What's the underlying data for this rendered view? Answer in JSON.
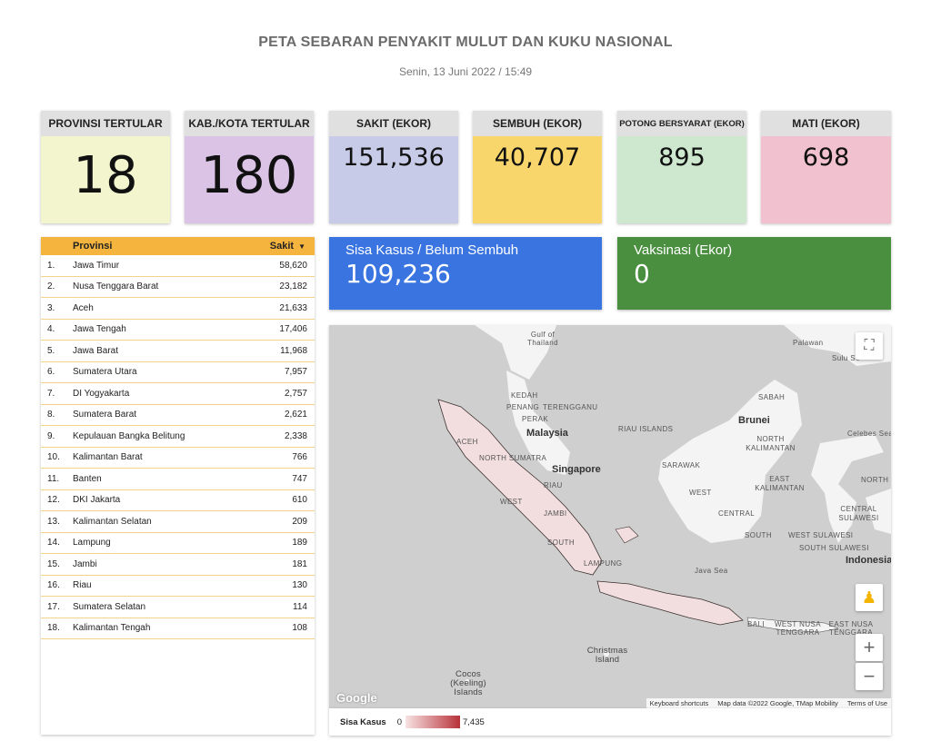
{
  "header": {
    "title": "PETA SEBARAN PENYAKIT MULUT DAN KUKU NASIONAL",
    "date": "Senin, 13 Juni 2022 / 15:49"
  },
  "cards": [
    {
      "label": "PROVINSI TERTULAR",
      "value": "18",
      "color": "#f2f5cd"
    },
    {
      "label": "KAB./KOTA TERTULAR",
      "value": "180",
      "color": "#dbc3e6"
    },
    {
      "label": "SAKIT (EKOR)",
      "value": "151,536",
      "color": "#c8cbe8"
    },
    {
      "label": "SEMBUH (EKOR)",
      "value": "40,707",
      "color": "#f8d66b"
    },
    {
      "label": "POTONG BERSYARAT (EKOR)",
      "value": "895",
      "color": "#cde8cf"
    },
    {
      "label": "MATI (EKOR)",
      "value": "698",
      "color": "#f2c1d0"
    }
  ],
  "sisa": {
    "label": "Sisa Kasus / Belum Sembuh",
    "value": "109,236",
    "color": "#3a74e0"
  },
  "vaksinasi": {
    "label": "Vaksinasi (Ekor)",
    "value": "0",
    "color": "#4a8f3f"
  },
  "table": {
    "col_name": "Provinsi",
    "col_value": "Sakit",
    "sort_icon": "triangle-down-icon",
    "rows": [
      {
        "n": "1.",
        "name": "Jawa Timur",
        "value": "58,620"
      },
      {
        "n": "2.",
        "name": "Nusa Tenggara Barat",
        "value": "23,182"
      },
      {
        "n": "3.",
        "name": "Aceh",
        "value": "21,633"
      },
      {
        "n": "4.",
        "name": "Jawa Tengah",
        "value": "17,406"
      },
      {
        "n": "5.",
        "name": "Jawa Barat",
        "value": "11,968"
      },
      {
        "n": "6.",
        "name": "Sumatera Utara",
        "value": "7,957"
      },
      {
        "n": "7.",
        "name": "DI Yogyakarta",
        "value": "2,757"
      },
      {
        "n": "8.",
        "name": "Sumatera Barat",
        "value": "2,621"
      },
      {
        "n": "9.",
        "name": "Kepulauan Bangka Belitung",
        "value": "2,338"
      },
      {
        "n": "10.",
        "name": "Kalimantan Barat",
        "value": "766"
      },
      {
        "n": "11.",
        "name": "Banten",
        "value": "747"
      },
      {
        "n": "12.",
        "name": "DKI Jakarta",
        "value": "610"
      },
      {
        "n": "13.",
        "name": "Kalimantan Selatan",
        "value": "209"
      },
      {
        "n": "14.",
        "name": "Lampung",
        "value": "189"
      },
      {
        "n": "15.",
        "name": "Jambi",
        "value": "181"
      },
      {
        "n": "16.",
        "name": "Riau",
        "value": "130"
      },
      {
        "n": "17.",
        "name": "Sumatera Selatan",
        "value": "114"
      },
      {
        "n": "18.",
        "name": "Kalimantan Tengah",
        "value": "108"
      }
    ]
  },
  "map": {
    "labels": {
      "gulf": "Gulf of Thailand",
      "palawan": "Palawan",
      "sulu": "Sulu Se",
      "kedah": "KEDAH",
      "terengganu": "TERENGGANU",
      "penang": "PENANG",
      "perak": "PERAK",
      "malaysia": "Malaysia",
      "riau_islands": "RIAU ISLANDS",
      "sabah": "SABAH",
      "brunei": "Brunei",
      "north_kalimantan": "NORTH KALIMANTAN",
      "celebes": "Celebes Sea",
      "aceh": "ACEH",
      "north_sumatra": "NORTH SUMATRA",
      "singapore": "Singapore",
      "sarawak": "SARAWAK",
      "east_kalimantan": "EAST KALIMANTAN",
      "north": "NORTH",
      "west_kal": "WEST",
      "central_kal": "CENTRAL",
      "south_kal": "SOUTH",
      "central_sulawesi": "CENTRAL SULAWESI",
      "west_sulawesi": "WEST SULAWESI",
      "south_sulawesi": "SOUTH SULAWESI",
      "indonesia": "Indonesia",
      "jambi": "JAMBI",
      "riau": "RIAU",
      "west": "WEST",
      "south": "SOUTH",
      "lampung": "LAMPUNG",
      "java_sea": "Java Sea",
      "bali": "BALI",
      "west_nusa": "WEST NUSA TENGGARA",
      "east_nusa": "EAST NUSA TENGGARA",
      "christmas": "Christmas Island",
      "cocos": "Cocos (Keeling) Islands"
    },
    "google": "Google",
    "keyboard": "Keyboard shortcuts",
    "mapdata": "Map data ©2022 Google, TMap Mobility",
    "terms": "Terms of Use",
    "fullscreen_icon": "fullscreen-icon",
    "pegman_icon": "pegman-icon",
    "zoom_in": "+",
    "zoom_out": "−"
  },
  "legend": {
    "label": "Sisa Kasus",
    "min": "0",
    "max": "7,435"
  }
}
